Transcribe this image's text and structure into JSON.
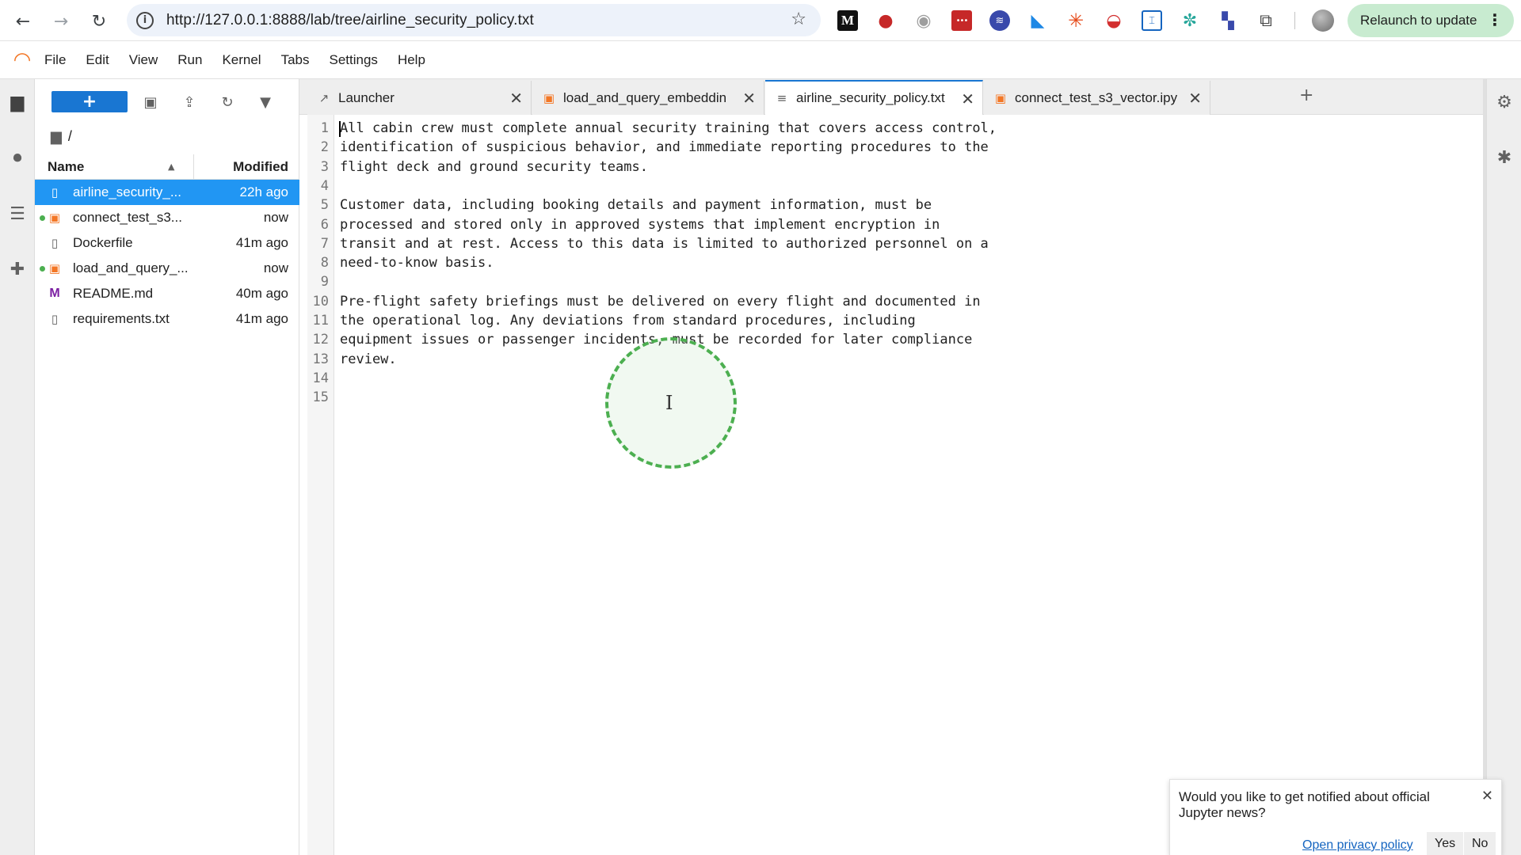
{
  "browser": {
    "url": "http://127.0.0.1:8888/lab/tree/airline_security_policy.txt",
    "relaunch_label": "Relaunch to update",
    "extensions": [
      {
        "name": "medium-icon",
        "glyph": "M"
      },
      {
        "name": "tomato-icon",
        "glyph": "●"
      },
      {
        "name": "ghost-icon",
        "glyph": "◉"
      },
      {
        "name": "dots-box-icon",
        "glyph": "•••"
      },
      {
        "name": "blue-circle-icon",
        "glyph": "≋"
      },
      {
        "name": "triangle-icon",
        "glyph": "◣"
      },
      {
        "name": "sunburst-icon",
        "glyph": "✳"
      },
      {
        "name": "pokeball-icon",
        "glyph": "◒"
      },
      {
        "name": "scan-icon",
        "glyph": "⌶"
      },
      {
        "name": "atom-icon",
        "glyph": "✼"
      },
      {
        "name": "puzzle-blue-icon",
        "glyph": "▚"
      },
      {
        "name": "extensions-puzzle-icon",
        "glyph": "⧉"
      }
    ]
  },
  "menubar": {
    "items": [
      "File",
      "Edit",
      "View",
      "Run",
      "Kernel",
      "Tabs",
      "Settings",
      "Help"
    ]
  },
  "filebrowser": {
    "new_label": "+",
    "breadcrumb": "/",
    "header_name": "Name",
    "header_modified": "Modified",
    "files": [
      {
        "name": "airline_security_...",
        "modified": "22h ago",
        "type": "text",
        "selected": true,
        "running": false
      },
      {
        "name": "connect_test_s3...",
        "modified": "now",
        "type": "notebook",
        "selected": false,
        "running": true
      },
      {
        "name": "Dockerfile",
        "modified": "41m ago",
        "type": "text",
        "selected": false,
        "running": false
      },
      {
        "name": "load_and_query_...",
        "modified": "now",
        "type": "notebook",
        "selected": false,
        "running": true
      },
      {
        "name": "README.md",
        "modified": "40m ago",
        "type": "markdown",
        "selected": false,
        "running": false
      },
      {
        "name": "requirements.txt",
        "modified": "41m ago",
        "type": "text",
        "selected": false,
        "running": false
      }
    ]
  },
  "tabs": [
    {
      "label": "Launcher",
      "type": "launcher",
      "active": false
    },
    {
      "label": "load_and_query_embeddin",
      "type": "notebook",
      "active": false
    },
    {
      "label": "airline_security_policy.txt",
      "type": "text",
      "active": true
    },
    {
      "label": "connect_test_s3_vector.ipy",
      "type": "notebook",
      "active": false
    }
  ],
  "editor": {
    "lines": [
      "All cabin crew must complete annual security training that covers access control,",
      "identification of suspicious behavior, and immediate reporting procedures to the",
      "flight deck and ground security teams.",
      "",
      "Customer data, including booking details and payment information, must be",
      "processed and stored only in approved systems that implement encryption in",
      "transit and at rest. Access to this data is limited to authorized personnel on a",
      "need-to-know basis.",
      "",
      "Pre-flight safety briefings must be delivered on every flight and documented in",
      "the operational log. Any deviations from standard procedures, including",
      "equipment issues or passenger incidents, must be recorded for later compliance",
      "review.",
      "",
      ""
    ]
  },
  "notification": {
    "message": "Would you like to get notified about official Jupyter news?",
    "privacy_link": "Open privacy policy",
    "yes_label": "Yes",
    "no_label": "No"
  }
}
